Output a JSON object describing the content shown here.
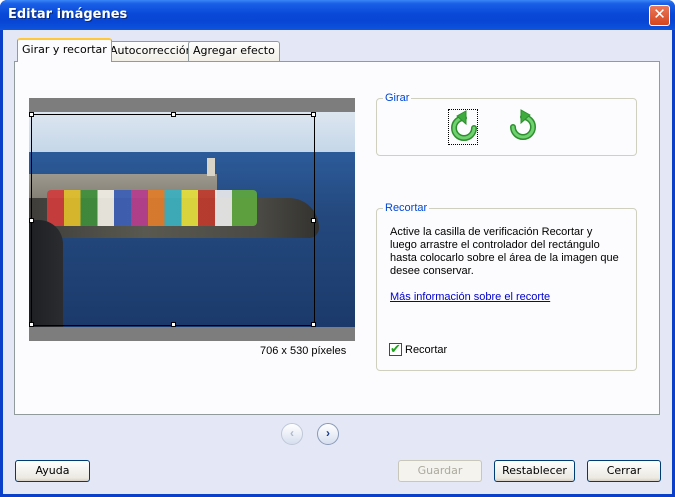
{
  "window": {
    "title": "Editar imágenes",
    "close_glyph": "✕"
  },
  "tabs": [
    {
      "label": "Girar y recortar",
      "active": true
    },
    {
      "label": "Autocorrección",
      "active": false
    },
    {
      "label": "Agregar efecto",
      "active": false
    }
  ],
  "image": {
    "size_text": "706 x 530 píxeles"
  },
  "rotate": {
    "title": "Girar",
    "left_icon": "rotate-left-icon",
    "right_icon": "rotate-right-icon"
  },
  "crop": {
    "title": "Recortar",
    "description": "Active la casilla de verificación Recortar y luego arrastre el controlador del rectángulo hasta colocarlo sobre el área de la imagen que desee conservar.",
    "link": "Más información sobre el recorte",
    "checkbox_label": "Recortar",
    "checked": true,
    "check_glyph": "✔"
  },
  "nav": {
    "prev_glyph": "‹",
    "next_glyph": "›"
  },
  "buttons": {
    "help": "Ayuda",
    "save": "Guardar",
    "reset": "Restablecer",
    "close": "Cerrar"
  },
  "colors": {
    "title_bar": "#0a4ad8",
    "group_title": "#0046d5",
    "rotate_icon": "#3dab3d",
    "active_tab_accent": "#ffc83c"
  }
}
